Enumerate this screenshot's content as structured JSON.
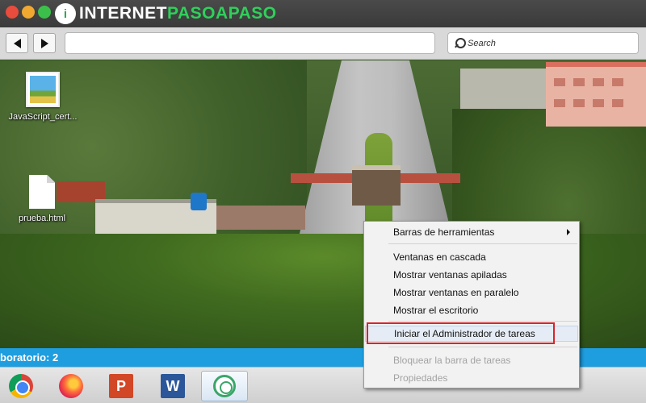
{
  "branding": {
    "text_a": "INTERNET",
    "text_b": "PASOAPASO",
    "mark": "i"
  },
  "search": {
    "placeholder": "Search"
  },
  "desktop_icons": [
    {
      "label": "JavaScript_cert...",
      "icon": "image-file-icon"
    },
    {
      "label": "prueba.html",
      "icon": "document-file-icon"
    }
  ],
  "status_text": "boratorio: 2",
  "taskbar": {
    "apps": [
      {
        "name": "chrome",
        "icon": "chrome-icon"
      },
      {
        "name": "firefox",
        "icon": "firefox-icon"
      },
      {
        "name": "powerpoint",
        "icon": "powerpoint-icon",
        "glyph": "P"
      },
      {
        "name": "word",
        "icon": "word-icon",
        "glyph": "W"
      },
      {
        "name": "seal-app",
        "icon": "seal-app-icon",
        "active": true
      }
    ]
  },
  "context_menu": {
    "items": [
      {
        "label": "Barras de herramientas",
        "has_submenu": true,
        "enabled": true
      },
      {
        "label": "Ventanas en cascada",
        "enabled": true
      },
      {
        "label": "Mostrar ventanas apiladas",
        "enabled": true
      },
      {
        "label": "Mostrar ventanas en paralelo",
        "enabled": true
      },
      {
        "label": "Mostrar el escritorio",
        "enabled": true
      },
      {
        "label": "Iniciar el Administrador de tareas",
        "enabled": true,
        "highlighted": true
      },
      {
        "label": "Bloquear la barra de tareas",
        "enabled": false
      },
      {
        "label": "Propiedades",
        "enabled": false
      }
    ]
  },
  "colors": {
    "status_bar": "#1e9ddf",
    "highlight_border": "#d9242b",
    "brand_green": "#2fd05a"
  }
}
